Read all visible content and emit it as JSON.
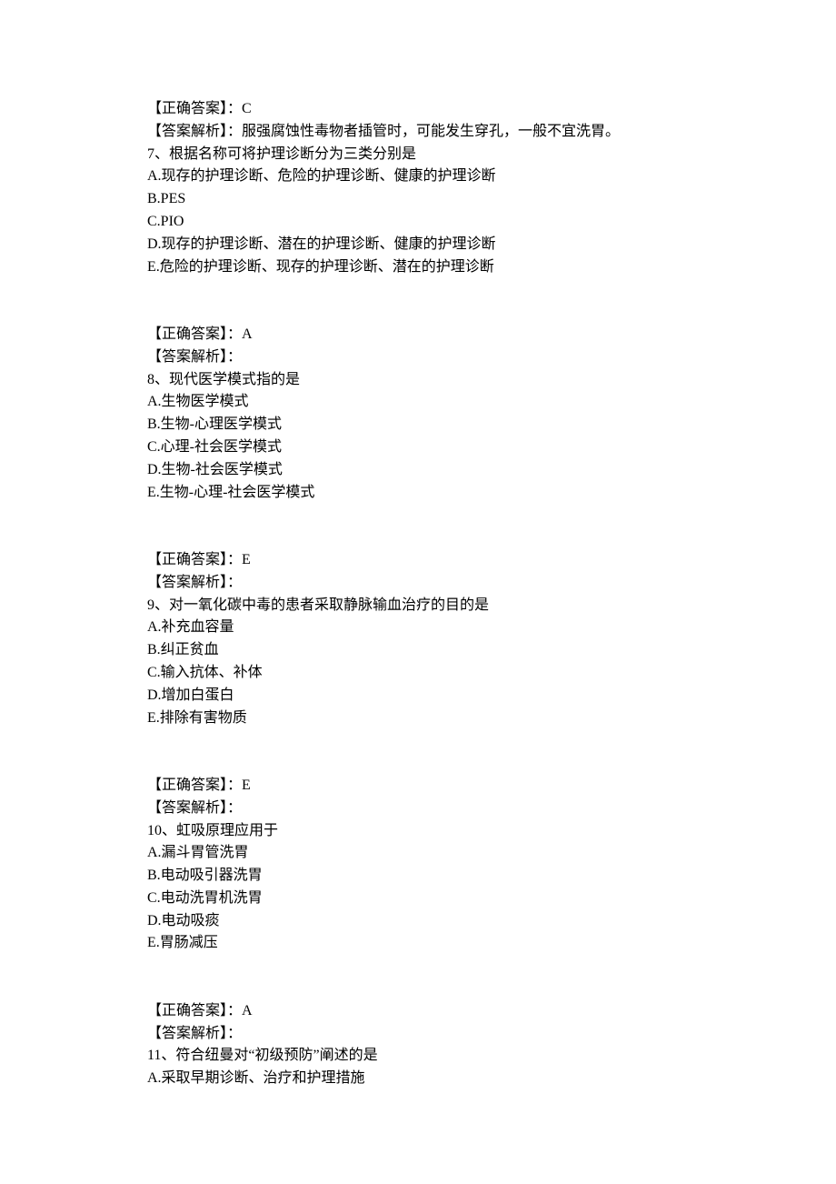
{
  "blocks": [
    {
      "text": "【正确答案】：C"
    },
    {
      "text": "【答案解析】：服强腐蚀性毒物者插管时，可能发生穿孔，一般不宜洗胃。"
    },
    {
      "text": "7、根据名称可将护理诊断分为三类分别是"
    },
    {
      "text": "A.现存的护理诊断、危险的护理诊断、健康的护理诊断"
    },
    {
      "text": "B.PES"
    },
    {
      "text": "C.PIO"
    },
    {
      "text": "D.现存的护理诊断、潜在的护理诊断、健康的护理诊断"
    },
    {
      "text": "E.危险的护理诊断、现存的护理诊断、潜在的护理诊断"
    },
    {
      "spacer": true
    },
    {
      "spacer": true
    },
    {
      "text": "【正确答案】：A"
    },
    {
      "text": "【答案解析】："
    },
    {
      "text": "8、现代医学模式指的是"
    },
    {
      "text": "A.生物医学模式"
    },
    {
      "text": "B.生物-心理医学模式"
    },
    {
      "text": "C.心理-社会医学模式"
    },
    {
      "text": "D.生物-社会医学模式"
    },
    {
      "text": "E.生物-心理-社会医学模式"
    },
    {
      "spacer": true
    },
    {
      "spacer": true
    },
    {
      "text": "【正确答案】：E"
    },
    {
      "text": "【答案解析】："
    },
    {
      "text": "9、对一氧化碳中毒的患者采取静脉输血治疗的目的是"
    },
    {
      "text": "A.补充血容量"
    },
    {
      "text": "B.纠正贫血"
    },
    {
      "text": "C.输入抗体、补体"
    },
    {
      "text": "D.增加白蛋白"
    },
    {
      "text": "E.排除有害物质"
    },
    {
      "spacer": true
    },
    {
      "spacer": true
    },
    {
      "text": "【正确答案】：E"
    },
    {
      "text": "【答案解析】："
    },
    {
      "text": "10、虹吸原理应用于"
    },
    {
      "text": "A.漏斗胃管洗胃"
    },
    {
      "text": "B.电动吸引器洗胃"
    },
    {
      "text": "C.电动洗胃机洗胃"
    },
    {
      "text": "D.电动吸痰"
    },
    {
      "text": "E.胃肠减压"
    },
    {
      "spacer": true
    },
    {
      "spacer": true
    },
    {
      "text": "【正确答案】：A"
    },
    {
      "text": "【答案解析】："
    },
    {
      "text": "11、符合纽曼对“初级预防”阐述的是"
    },
    {
      "text": "A.采取早期诊断、治疗和护理措施"
    }
  ]
}
